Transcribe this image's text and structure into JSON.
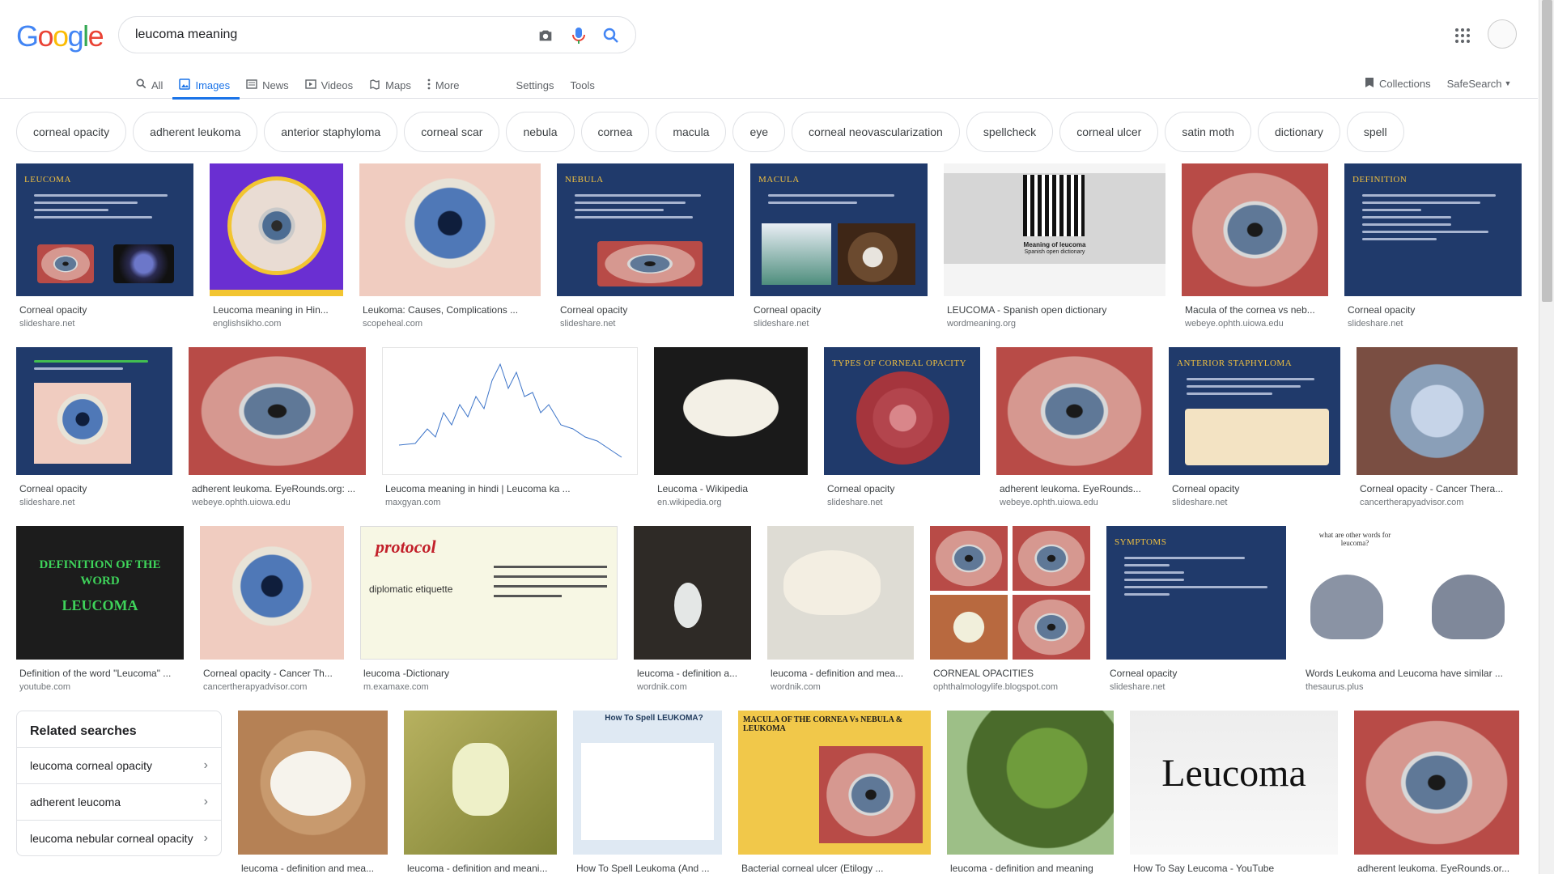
{
  "header": {
    "logo": [
      "G",
      "o",
      "o",
      "g",
      "l",
      "e"
    ],
    "logo_colors": [
      "#4285F4",
      "#EA4335",
      "#FBBC05",
      "#4285F4",
      "#34A853",
      "#EA4335"
    ],
    "search_value": "leucoma meaning"
  },
  "tabs": [
    {
      "label": "All",
      "icon": "search-icon"
    },
    {
      "label": "Images",
      "icon": "image-icon",
      "active": true
    },
    {
      "label": "News",
      "icon": "news-icon"
    },
    {
      "label": "Videos",
      "icon": "video-icon"
    },
    {
      "label": "Maps",
      "icon": "map-icon"
    },
    {
      "label": "More",
      "icon": "kebab-icon"
    },
    {
      "label": "Settings"
    },
    {
      "label": "Tools"
    }
  ],
  "right_tools": {
    "collections": "Collections",
    "safesearch": "SafeSearch"
  },
  "chips": [
    "corneal opacity",
    "adherent leukoma",
    "anterior staphyloma",
    "corneal scar",
    "nebula",
    "cornea",
    "macula",
    "eye",
    "corneal neovascularization",
    "spellcheck",
    "corneal ulcer",
    "satin moth",
    "dictionary",
    "spell"
  ],
  "rows": [
    [
      {
        "caption": "Corneal opacity",
        "source": "slideshare.net",
        "slide_title": "LEUCOMA"
      },
      {
        "caption": "Leucoma meaning in Hin...",
        "source": "englishsikho.com"
      },
      {
        "caption": "Leukoma: Causes, Complications ...",
        "source": "scopeheal.com"
      },
      {
        "caption": "Corneal opacity",
        "source": "slideshare.net",
        "slide_title": "NEBULA"
      },
      {
        "caption": "Corneal opacity",
        "source": "slideshare.net",
        "slide_title": "MACULA"
      },
      {
        "caption": "LEUCOMA - Spanish open dictionary",
        "source": "wordmeaning.org",
        "inner1": "Meaning of leucoma",
        "inner2": "Spanish open dictionary"
      },
      {
        "caption": "Macula of the cornea vs neb...",
        "source": "webeye.ophth.uiowa.edu"
      },
      {
        "caption": "Corneal opacity",
        "source": "slideshare.net",
        "slide_title": "DEFINITION"
      }
    ],
    [
      {
        "caption": "Corneal opacity",
        "source": "slideshare.net"
      },
      {
        "caption": "adherent leukoma. EyeRounds.org: ...",
        "source": "webeye.ophth.uiowa.edu"
      },
      {
        "caption": "Leucoma meaning in hindi | Leucoma ka ...",
        "source": "maxgyan.com"
      },
      {
        "caption": "Leucoma - Wikipedia",
        "source": "en.wikipedia.org"
      },
      {
        "caption": "Corneal opacity",
        "source": "slideshare.net",
        "slide_title": "TYPES OF CORNEAL OPACITY"
      },
      {
        "caption": "adherent leukoma. EyeRounds...",
        "source": "webeye.ophth.uiowa.edu"
      },
      {
        "caption": "Corneal opacity",
        "source": "slideshare.net",
        "slide_title": "ANTERIOR STAPHYLOMA"
      },
      {
        "caption": "Corneal opacity - Cancer Thera...",
        "source": "cancertherapyadvisor.com"
      }
    ],
    [
      {
        "caption": "Definition of the word \"Leucoma\" ...",
        "source": "youtube.com",
        "inner1": "DEFINITION OF THE WORD",
        "inner2": "LEUCOMA"
      },
      {
        "caption": "Corneal opacity - Cancer Th...",
        "source": "cancertherapyadvisor.com"
      },
      {
        "caption": "leucoma -Dictionary",
        "source": "m.examaxe.com",
        "inner1": "protocol",
        "inner2": "diplomatic etiquette"
      },
      {
        "caption": "leucoma - definition a...",
        "source": "wordnik.com"
      },
      {
        "caption": "leucoma - definition and mea...",
        "source": "wordnik.com"
      },
      {
        "caption": "CORNEAL OPACITIES",
        "source": "ophthalmologylife.blogspot.com"
      },
      {
        "caption": "Corneal opacity",
        "source": "slideshare.net",
        "slide_title": "SYMPTOMS"
      },
      {
        "caption": "Words Leukoma and Leucoma have similar ...",
        "source": "thesaurus.plus",
        "inner1": "what are other words for leucoma?"
      }
    ],
    [
      {
        "caption": "leucoma - definition and mea...",
        "source": ""
      },
      {
        "caption": "leucoma - definition and meani...",
        "source": ""
      },
      {
        "caption": "How To Spell Leukoma (And ...",
        "source": "",
        "inner1": "How To Spell LEUKOMA?"
      },
      {
        "caption": "Bacterial corneal ulcer (Etilogy ...",
        "source": "",
        "inner1": "MACULA OF THE CORNEA Vs NEBULA & LEUKOMA"
      },
      {
        "caption": "leucoma - definition and meaning",
        "source": ""
      },
      {
        "caption": "How To Say Leucoma - YouTube",
        "source": "",
        "inner1": "Leucoma"
      },
      {
        "caption": "adherent leukoma. EyeRounds.or...",
        "source": ""
      }
    ]
  ],
  "related": {
    "title": "Related searches",
    "items": [
      "leucoma corneal opacity",
      "adherent leucoma",
      "leucoma nebular corneal opacity"
    ]
  },
  "colors": {
    "accent": "#1a73e8",
    "slide_bg": "#203a6b",
    "slide_title": "#f0c040"
  }
}
